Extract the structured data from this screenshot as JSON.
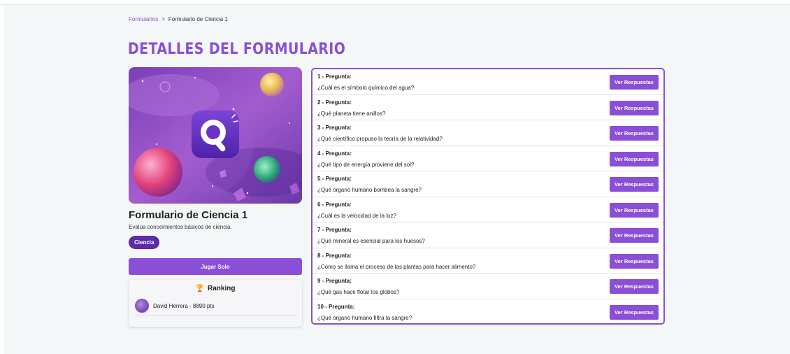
{
  "breadcrumb": {
    "root": "Formularios",
    "separator": ">",
    "current": "Formulario de Ciencia 1"
  },
  "page_title": "DETALLES DEL FORMULARIO",
  "form": {
    "name": "Formulario de Ciencia 1",
    "description": "Evalúa conocimientos básicos de ciencia.",
    "tag": "Ciencia",
    "play_label": "Jugar Solo"
  },
  "ranking": {
    "title": "Ranking",
    "trophy_icon": "🏆",
    "entries": [
      {
        "text": "David Herrera - 8890 pts"
      }
    ]
  },
  "questions": [
    {
      "number": "1 - Pregunta:",
      "text": "¿Cuál es el símbolo químico del agua?",
      "button": "Ver Respuestas"
    },
    {
      "number": "2 - Pregunta:",
      "text": "¿Qué planeta tiene anillos?",
      "button": "Ver Respuestas"
    },
    {
      "number": "3 - Pregunta:",
      "text": "¿Qué científico propuso la teoría de la relatividad?",
      "button": "Ver Respuestas"
    },
    {
      "number": "4 - Pregunta:",
      "text": "¿Qué tipo de energía proviene del sol?",
      "button": "Ver Respuestas"
    },
    {
      "number": "5 - Pregunta:",
      "text": "¿Qué órgano humano bombea la sangre?",
      "button": "Ver Respuestas"
    },
    {
      "number": "6 - Pregunta:",
      "text": "¿Cuál es la velocidad de la luz?",
      "button": "Ver Respuestas"
    },
    {
      "number": "7 - Pregunta:",
      "text": "¿Qué mineral es esencial para los huesos?",
      "button": "Ver Respuestas"
    },
    {
      "number": "8 - Pregunta:",
      "text": "¿Cómo se llama el proceso de las plantas para hacer alimento?",
      "button": "Ver Respuestas"
    },
    {
      "number": "9 - Pregunta:",
      "text": "¿Qué gas hace flotar los globos?",
      "button": "Ver Respuestas"
    },
    {
      "number": "10 - Pregunta:",
      "text": "¿Qué órgano humano filtra la sangre?",
      "button": "Ver Respuestas"
    }
  ],
  "colors": {
    "accent": "#8a4fd6",
    "tag_bg": "#5e2aa8",
    "page_bg": "#f3f7f8"
  }
}
